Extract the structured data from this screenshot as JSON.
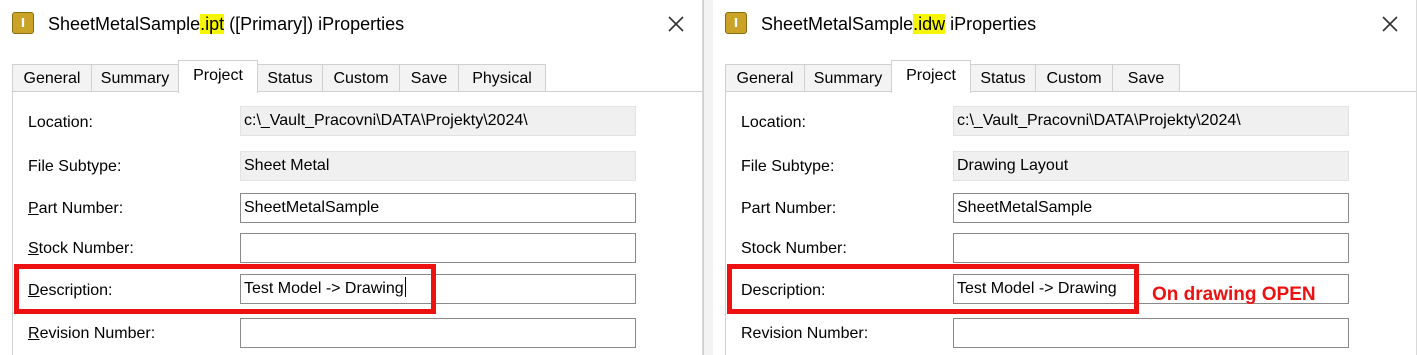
{
  "left": {
    "title_pre": "SheetMetalSample",
    "title_ext": ".ipt",
    "title_post": " ([Primary]) iProperties",
    "tabs": [
      "General",
      "Summary",
      "Project",
      "Status",
      "Custom",
      "Save",
      "Physical"
    ],
    "active_tab": "Project",
    "location_label": "Location:",
    "location_value": "c:\\_Vault_Pracovni\\DATA\\Projekty\\2024\\",
    "subtype_label": "File Subtype:",
    "subtype_value": "Sheet Metal",
    "part_number_label_u": "P",
    "part_number_label_rest": "art Number:",
    "part_number_value": "SheetMetalSample",
    "stock_number_label_u": "S",
    "stock_number_label_rest": "tock Number:",
    "stock_number_value": "",
    "description_label_u": "D",
    "description_label_rest": "escription:",
    "description_value": "Test Model -> Drawing",
    "revision_label_u": "R",
    "revision_label_rest": "evision Number:",
    "revision_value": ""
  },
  "right": {
    "title_pre": "SheetMetalSample",
    "title_ext": ".idw",
    "title_post": " iProperties",
    "tabs": [
      "General",
      "Summary",
      "Project",
      "Status",
      "Custom",
      "Save"
    ],
    "active_tab": "Project",
    "location_label": "Location:",
    "location_value": "c:\\_Vault_Pracovni\\DATA\\Projekty\\2024\\",
    "subtype_label": "File Subtype:",
    "subtype_value": "Drawing Layout",
    "part_number_label": "Part Number:",
    "part_number_value": "SheetMetalSample",
    "stock_number_label": "Stock Number:",
    "stock_number_value": "",
    "description_label": "Description:",
    "description_value": "Test Model -> Drawing",
    "revision_label": "Revision Number:",
    "revision_value": ""
  },
  "annotation": {
    "note": "On drawing OPEN",
    "color": "#ee1111"
  },
  "colors": {
    "highlight": "#f5f500",
    "readonly_field": "#f0f0f0"
  },
  "icons": {
    "app_icon": "inventor-file-icon",
    "close": "close-icon"
  }
}
